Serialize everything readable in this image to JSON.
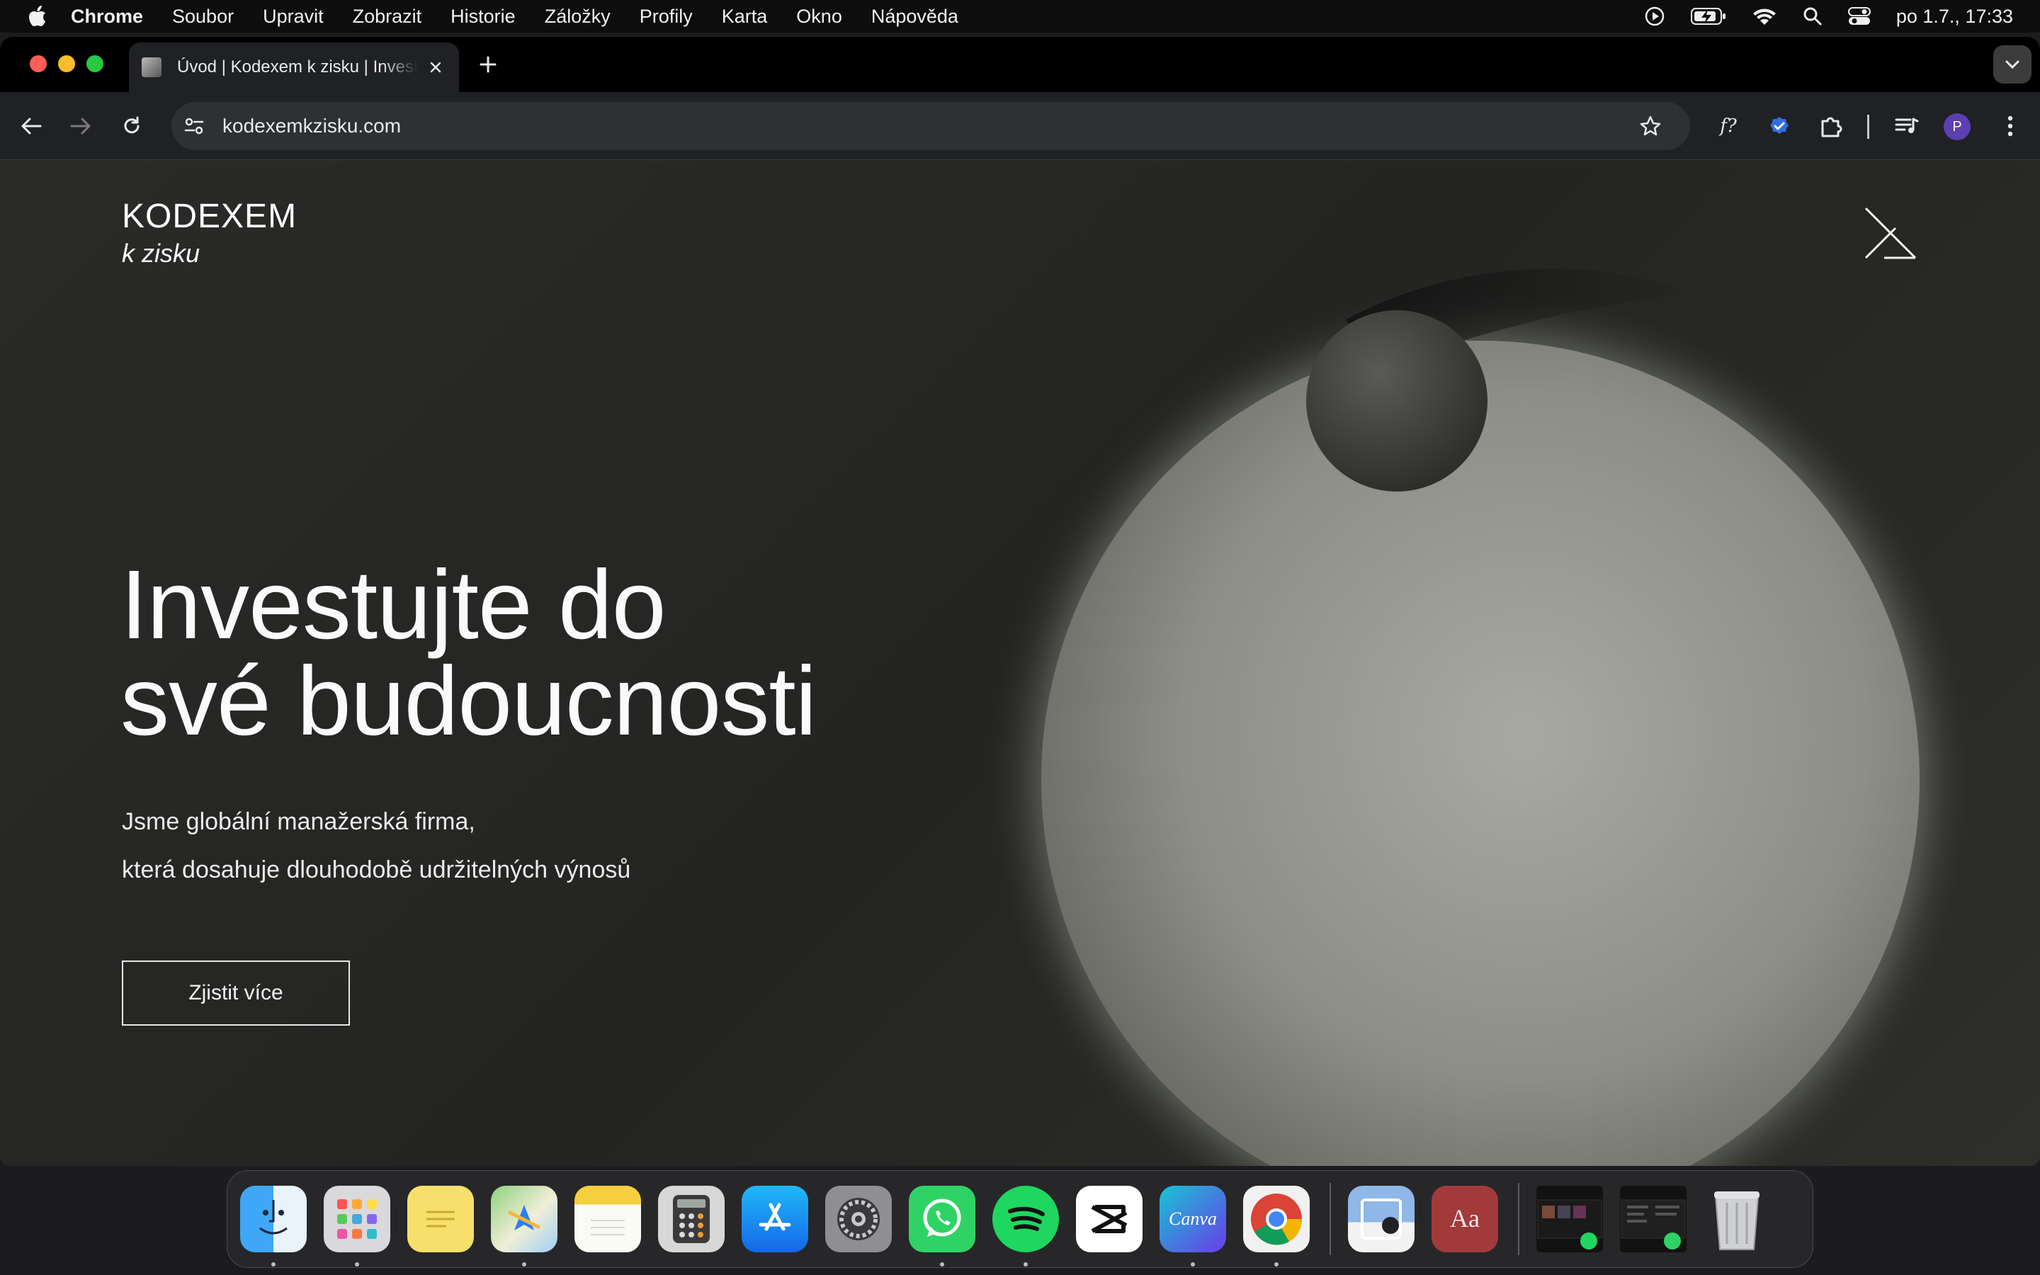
{
  "menubar": {
    "app_name": "Chrome",
    "items": [
      "Soubor",
      "Upravit",
      "Zobrazit",
      "Historie",
      "Záložky",
      "Profily",
      "Karta",
      "Okno",
      "Nápověda"
    ],
    "clock": "po 1.7., 17:33",
    "status_icons": [
      "screen-record-icon",
      "battery-charging-icon",
      "wifi-icon",
      "spotlight-search-icon",
      "control-center-icon"
    ]
  },
  "browser": {
    "tab_title": "Úvod | Kodexem k zisku | Investice",
    "url": "kodexemkzisku.com",
    "profile_initial": "P",
    "extensions": [
      "fx-extension-icon",
      "verified-extension-icon",
      "extensions-puzzle-icon",
      "media-control-icon"
    ]
  },
  "page": {
    "logo_main": "KODEXEM",
    "logo_sub": "k zisku",
    "hero_title_line1": "Investujte do",
    "hero_title_line2": "své budoucnosti",
    "hero_text_line1": "Jsme globální manažerská firma,",
    "hero_text_line2": "která dosahuje dlouhodobě udržitelných výnosů",
    "cta_label": "Zjistit více"
  },
  "dock": {
    "apps": [
      "Finder",
      "Launchpad",
      "Stickies",
      "Maps",
      "Notes",
      "Calculator",
      "App Store",
      "System Settings",
      "WhatsApp",
      "Spotify",
      "CapCut",
      "Canva",
      "Chrome",
      "Preview",
      "Dictionary",
      "Spotify window",
      "WhatsApp window",
      "Trash"
    ]
  }
}
